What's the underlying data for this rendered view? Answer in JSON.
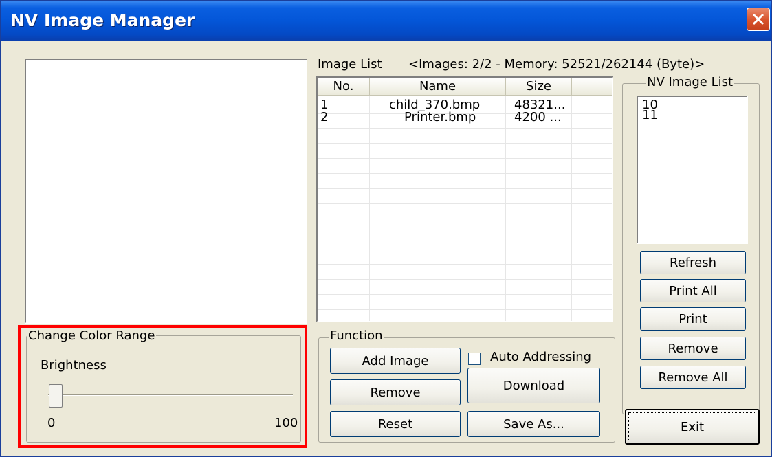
{
  "window": {
    "title": "NV Image Manager"
  },
  "image_list": {
    "label": "Image List",
    "info": "<Images: 2/2 - Memory: 52521/262144 (Byte)>",
    "columns": [
      "No.",
      "Name",
      "Size"
    ],
    "rows": [
      {
        "no": "1",
        "name": "child_370.bmp",
        "size": "48321..."
      },
      {
        "no": "2",
        "name": "Printer.bmp",
        "size": "4200 ..."
      }
    ]
  },
  "nv_image_list": {
    "label": "NV Image List",
    "items": [
      "10",
      "11"
    ],
    "buttons": {
      "refresh": "Refresh",
      "print_all": "Print All",
      "print": "Print",
      "remove": "Remove",
      "remove_all": "Remove All"
    }
  },
  "color_range": {
    "label": "Change Color Range",
    "brightness_label": "Brightness",
    "min_label": "0",
    "max_label": "100",
    "brightness_value": 0
  },
  "function": {
    "label": "Function",
    "add_image": "Add Image",
    "remove": "Remove",
    "reset": "Reset",
    "auto_addressing": "Auto Addressing",
    "auto_addressing_checked": false,
    "download": "Download",
    "save_as": "Save As..."
  },
  "exit_button": "Exit",
  "colors": {
    "titlebar": "#0456d8",
    "window_bg": "#ece9d8",
    "highlight_box": "#ff0000"
  }
}
